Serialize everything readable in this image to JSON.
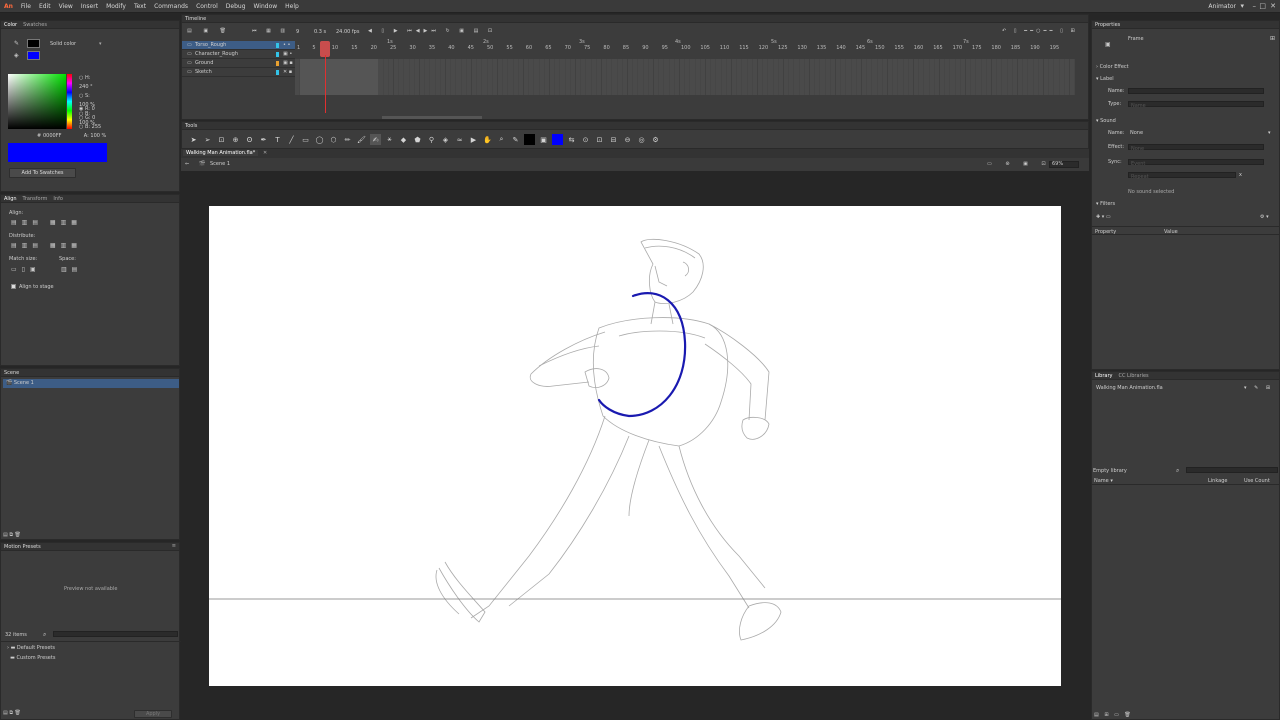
{
  "app": {
    "logo": "An",
    "menu": [
      "File",
      "Edit",
      "View",
      "Insert",
      "Modify",
      "Text",
      "Commands",
      "Control",
      "Debug",
      "Window",
      "Help"
    ],
    "workspace": "Animator"
  },
  "color_panel": {
    "tabs": [
      "Color",
      "Swatches"
    ],
    "fill_type": "Solid color",
    "hsb": {
      "h_label": "H:",
      "h": "240 °",
      "s_label": "S:",
      "s": "100 %",
      "b_label": "B:",
      "b": "100 %"
    },
    "rgb": {
      "r_label": "R:",
      "r": "0",
      "g_label": "G:",
      "g": "0",
      "b_label": "B:",
      "b": "255"
    },
    "alpha_label": "A:",
    "alpha": "100 %",
    "hex_label": "#",
    "hex": "0000FF",
    "swatch_color": "#0000FF",
    "add_swatch": "Add To Swatches"
  },
  "align_panel": {
    "tabs": [
      "Align",
      "Transform",
      "Info"
    ],
    "align": "Align:",
    "distribute": "Distribute:",
    "match_size": "Match size:",
    "space": "Space:",
    "align_to_stage": "Align to stage"
  },
  "scene_panel": {
    "title": "Scene",
    "item": "Scene 1"
  },
  "motion_presets": {
    "title": "Motion Presets",
    "preview": "Preview not available",
    "count": "32 items",
    "folders": [
      "Default Presets",
      "Custom Presets"
    ],
    "apply": "Apply"
  },
  "timeline": {
    "title": "Timeline",
    "fps": "24.00 fps",
    "time": "0.3 s",
    "frame": "9",
    "layers": [
      {
        "name": "Torso_Rough",
        "color": "#33c3e8",
        "selected": true
      },
      {
        "name": "Character_Rough",
        "color": "#33c3e8"
      },
      {
        "name": "Ground",
        "color": "#e8a030"
      },
      {
        "name": "Sketch",
        "color": "#33c3e8"
      }
    ],
    "ruler": [
      "1",
      "5",
      "10",
      "15",
      "20",
      "25",
      "30",
      "35",
      "40",
      "45",
      "50",
      "55",
      "60",
      "65",
      "70",
      "75",
      "80",
      "85",
      "90",
      "95",
      "100",
      "105",
      "110",
      "115",
      "120",
      "125",
      "130",
      "135",
      "140",
      "145",
      "150",
      "155",
      "160",
      "165",
      "170",
      "175",
      "180",
      "185",
      "190",
      "195"
    ],
    "seconds": [
      "1s",
      "2s",
      "3s",
      "4s",
      "5s",
      "6s",
      "7s"
    ]
  },
  "tools": {
    "title": "Tools"
  },
  "document": {
    "tab": "Walking Man Animation.fla*",
    "scene": "Scene 1",
    "zoom": "69%"
  },
  "properties": {
    "title": "Properties",
    "type": "Frame",
    "color_effect": "Color Effect",
    "label": "Label",
    "name_label": "Name:",
    "type_label": "Type:",
    "type_value": "Name",
    "sound": "Sound",
    "sound_name_label": "Name:",
    "sound_name": "None",
    "effect_label": "Effect:",
    "effect_value": "None",
    "sync_label": "Sync:",
    "sync_value": "Event",
    "repeat_value": "Repeat",
    "repeat_x": "x",
    "no_sound": "No sound selected",
    "filters": "Filters",
    "property_col": "Property",
    "value_col": "Value"
  },
  "library": {
    "tabs": [
      "Library",
      "CC Libraries"
    ],
    "file": "Walking Man Animation.fla",
    "empty": "Empty library",
    "name_col": "Name",
    "linkage_col": "Linkage",
    "use_col": "Use Count"
  },
  "colors": {
    "accent": "#0000FF",
    "stroke": "#1a1ab0"
  }
}
